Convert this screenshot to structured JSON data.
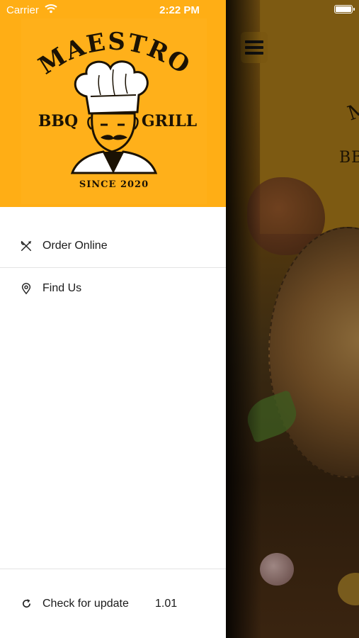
{
  "status_bar": {
    "carrier": "Carrier",
    "time": "2:22 PM"
  },
  "logo": {
    "top_text": "MAESTRO",
    "left_text": "BBQ",
    "right_text": "GRILL",
    "bottom_text": "SINCE 2020"
  },
  "menu": {
    "items": [
      {
        "label": "Order Online",
        "icon": "utensils-icon"
      },
      {
        "label": "Find Us",
        "icon": "location-pin-icon"
      }
    ]
  },
  "footer": {
    "check_update_label": "Check for update",
    "version": "1.01",
    "icon": "refresh-icon"
  },
  "background_app": {
    "partial_text_top": "M",
    "partial_text_bbq": "BB"
  },
  "colors": {
    "header_bg": "#ffae15",
    "text": "#1a1a1a"
  }
}
